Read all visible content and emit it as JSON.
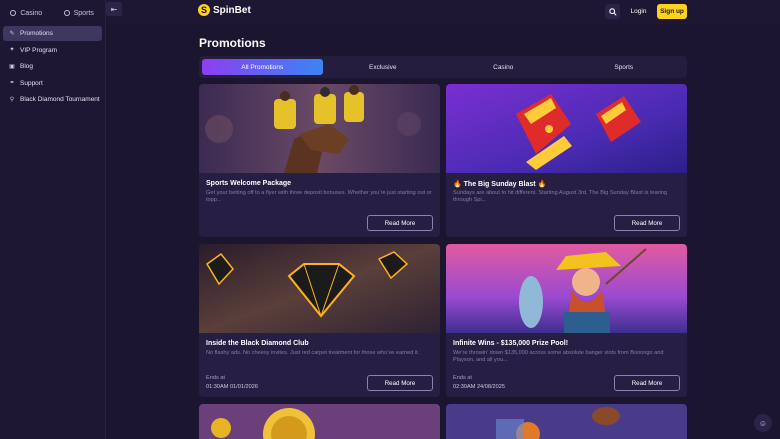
{
  "sidebar": {
    "switch": [
      {
        "label": "Casino",
        "icon": "casino-icon"
      },
      {
        "label": "Sports",
        "icon": "sports-icon"
      }
    ],
    "items": [
      {
        "label": "Promotions",
        "icon": "megaphone-icon",
        "active": true
      },
      {
        "label": "VIP Program",
        "icon": "vip-icon",
        "active": false
      },
      {
        "label": "Blog",
        "icon": "blog-icon",
        "active": false
      },
      {
        "label": "Support",
        "icon": "support-icon",
        "active": false
      },
      {
        "label": "Black Diamond Tournament",
        "icon": "trophy-icon",
        "active": false
      }
    ]
  },
  "header": {
    "logo_text": "SpinBet",
    "login_label": "Login",
    "signup_label": "Sign up"
  },
  "main": {
    "title": "Promotions",
    "tabs": [
      {
        "label": "All Promotions",
        "active": true
      },
      {
        "label": "Exclusive",
        "active": false
      },
      {
        "label": "Casino",
        "active": false
      },
      {
        "label": "Sports",
        "active": false
      }
    ],
    "cards": [
      {
        "title": "Sports Welcome Package",
        "description": "Get your betting off to a flyer with three deposit bonuses. Whether you’re just starting out or topp...",
        "button": "Read More"
      },
      {
        "title": "🔥 The Big Sunday Blast 🔥",
        "description": "Sundays are about to hit different. Starting August 3rd, The Big Sunday Blast is tearing through Spi...",
        "button": "Read More"
      },
      {
        "title": "Inside the Black Diamond Club",
        "description": "No flashy ads. No cheesy invites. Just red carpet treatment for those who’ve earned it.",
        "ends_label": "Ends at",
        "ends_value": "01:30AM 01/01/2026",
        "button": "Read More"
      },
      {
        "title": "Infinite Wins - $135,000 Prize Pool!",
        "description": "We’re throwin’ down $135,000 across some absolute banger slots from Booongo and Playson, and all you...",
        "ends_label": "Ends at",
        "ends_value": "02:30AM 24/08/2025",
        "button": "Read More"
      }
    ]
  },
  "colors": {
    "background": "#1b1530",
    "card": "#261e43",
    "accent_yellow": "#ffd21f",
    "tab_gradient_start": "#8b3ff0",
    "tab_gradient_end": "#3c84f5"
  }
}
